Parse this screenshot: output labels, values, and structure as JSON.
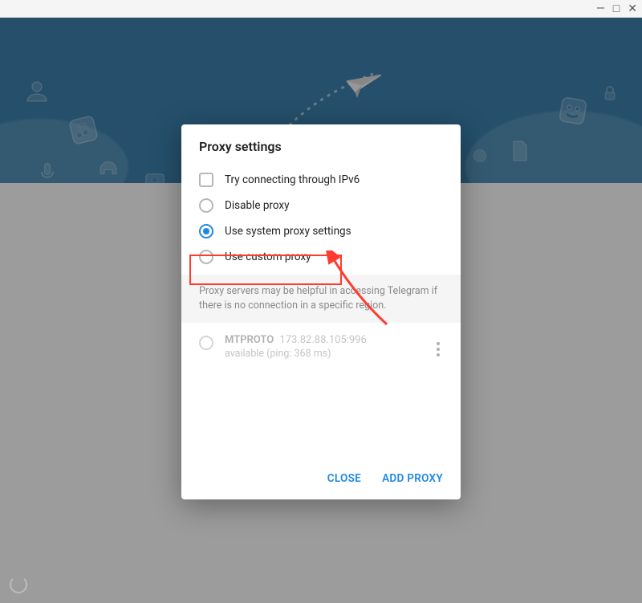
{
  "window": {
    "minimize": "—",
    "maximize": "□",
    "close": "✕"
  },
  "dialog": {
    "title": "Proxy settings",
    "options": {
      "ipv6": "Try connecting through IPv6",
      "disable": "Disable proxy",
      "system": "Use system proxy settings",
      "custom": "Use custom proxy"
    },
    "hint": "Proxy servers may be helpful in accessing Telegram if there is no connection in a specific region.",
    "proxy": {
      "name": "MTPROTO",
      "addr": "173.82.88.105:996",
      "status": "available (ping: 368 ms)"
    },
    "actions": {
      "close": "CLOSE",
      "add": "ADD PROXY"
    }
  }
}
